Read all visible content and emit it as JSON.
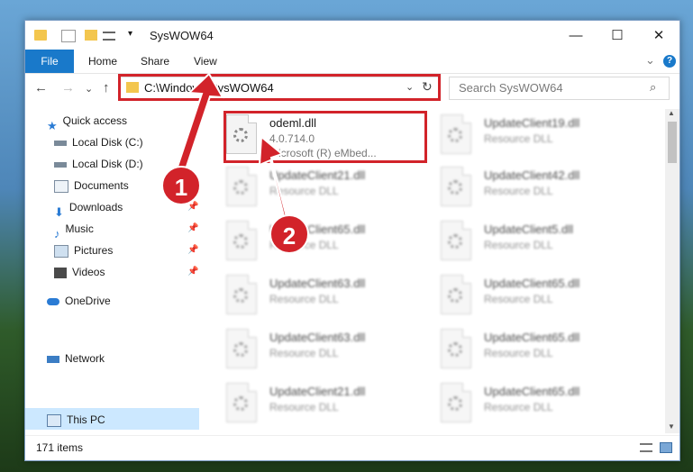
{
  "window": {
    "title": "SysWOW64",
    "controls": {
      "minimize": "—",
      "maximize": "☐",
      "close": "✕"
    }
  },
  "ribbon": {
    "tabs": [
      "File",
      "Home",
      "Share",
      "View"
    ],
    "help": "?",
    "expand": "⌄"
  },
  "nav": {
    "back": "←",
    "forward": "→",
    "recent": "⌄",
    "up": "↑",
    "address": "C:\\Windows\\SysWOW64",
    "search_placeholder": "Search SysWOW64"
  },
  "sidebar": {
    "items": [
      {
        "label": "Quick access",
        "icon": "star-icon"
      },
      {
        "label": "Local Disk (C:)",
        "icon": "drive-icon"
      },
      {
        "label": "Local Disk (D:)",
        "icon": "drive-icon"
      },
      {
        "label": "Documents",
        "icon": "documents-icon"
      },
      {
        "label": "Downloads",
        "icon": "downloads-icon"
      },
      {
        "label": "Music",
        "icon": "music-icon"
      },
      {
        "label": "Pictures",
        "icon": "pictures-icon"
      },
      {
        "label": "Videos",
        "icon": "videos-icon"
      },
      {
        "label": "OneDrive",
        "icon": "cloud-icon"
      },
      {
        "label": "This PC",
        "icon": "computer-icon"
      },
      {
        "label": "Network",
        "icon": "network-icon"
      }
    ]
  },
  "files": {
    "highlighted": {
      "name": "odeml.dll",
      "version": "4.0.714.0",
      "description": "Microsoft (R) eMbed..."
    },
    "left_column": [
      {
        "name": "UpdateClient21.dll",
        "type": "Resource DLL"
      },
      {
        "name": "UpdateClient65.dll",
        "type": "Resource DLL"
      },
      {
        "name": "UpdateClient63.dll",
        "type": "Resource DLL"
      },
      {
        "name": "UpdateClient63.dll",
        "type": "Resource DLL"
      },
      {
        "name": "UpdateClient21.dll",
        "type": "Resource DLL"
      }
    ],
    "right_column": [
      {
        "name": "UpdateClient19.dll",
        "type": "Resource DLL"
      },
      {
        "name": "UpdateClient42.dll",
        "type": "Resource DLL"
      },
      {
        "name": "UpdateClient5.dll",
        "type": "Resource DLL"
      },
      {
        "name": "UpdateClient65.dll",
        "type": "Resource DLL"
      },
      {
        "name": "UpdateClient65.dll",
        "type": "Resource DLL"
      },
      {
        "name": "UpdateClient65.dll",
        "type": "Resource DLL"
      }
    ]
  },
  "status": {
    "item_count": "171 items"
  },
  "annotations": {
    "badge1": "1",
    "badge2": "2",
    "color": "#d2232a"
  }
}
